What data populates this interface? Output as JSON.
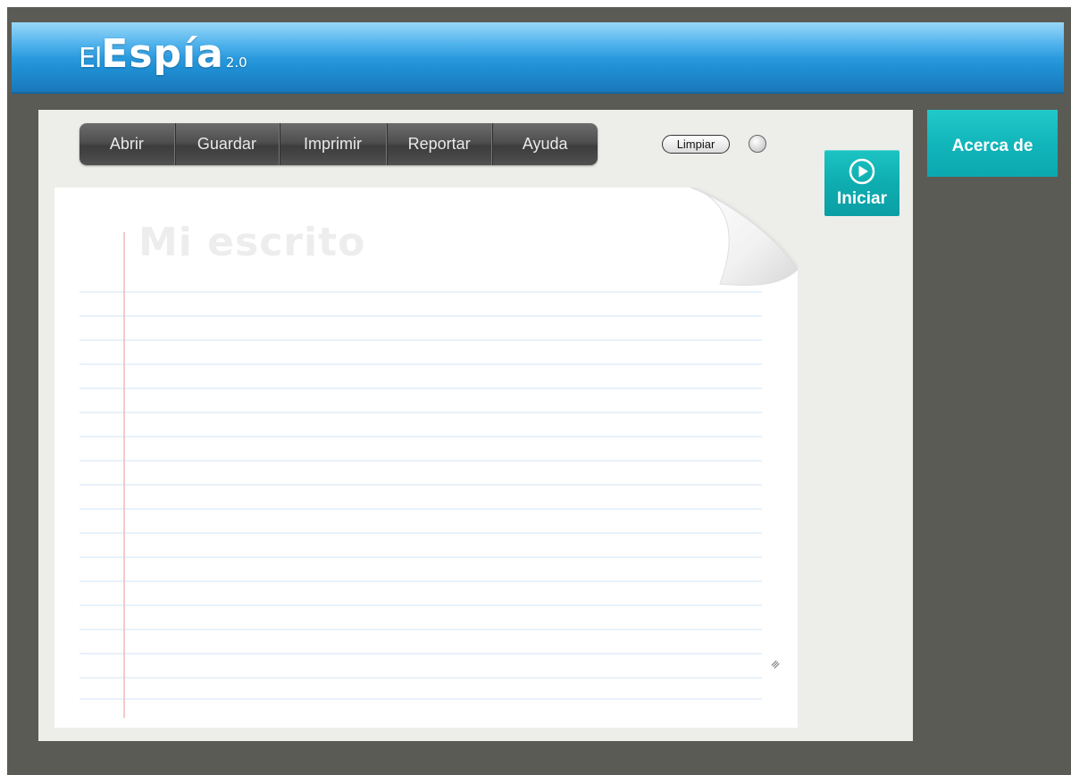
{
  "header": {
    "logo_prefix": "El",
    "logo_main": "Espía",
    "logo_version": "2.0"
  },
  "menu": {
    "items": [
      {
        "label": "Abrir"
      },
      {
        "label": "Guardar"
      },
      {
        "label": "Imprimir"
      },
      {
        "label": "Reportar"
      },
      {
        "label": "Ayuda"
      }
    ]
  },
  "controls": {
    "clear_label": "Limpiar",
    "start_label": "Iniciar",
    "about_label": "Acerca de"
  },
  "notepad": {
    "title": "Mi escrito",
    "text_value": ""
  },
  "colors": {
    "header_blue": "#1f8fd4",
    "teal_button": "#11b6bb",
    "background": "#5b5b55",
    "panel": "#ededea",
    "menu_bar": "#4f4f4f"
  },
  "icons": {
    "play": "play-circle-icon",
    "resize": "resize-grip-icon"
  }
}
